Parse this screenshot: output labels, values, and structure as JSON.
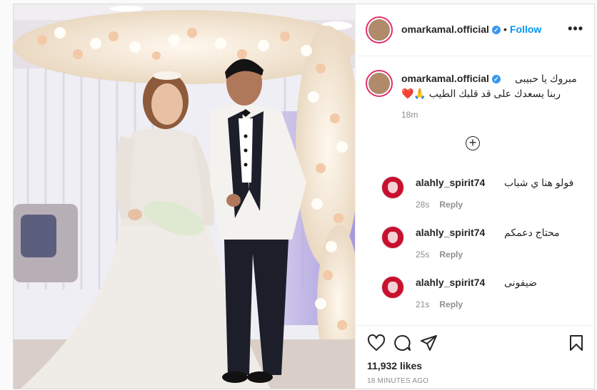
{
  "post": {
    "username": "omarkamal.official",
    "follow_label": "Follow",
    "dot": "•",
    "more": "•••",
    "verified_mark": "✓",
    "caption_line1": "مبروك يا حبيبى",
    "caption_line2": "ربنا يسعدك على قد قلبك الطيب 🙏❤️",
    "caption_time": "18m",
    "load_more": "+",
    "likes": "11,932 likes",
    "time_ago": "18 MINUTES AGO"
  },
  "comments": [
    {
      "username": "alahly_spirit74",
      "text": "فولو هنا ي شباب",
      "time": "28s",
      "reply": "Reply"
    },
    {
      "username": "alahly_spirit74",
      "text": "محتاج دعمكم",
      "time": "25s",
      "reply": "Reply"
    },
    {
      "username": "alahly_spirit74",
      "text": "ضيفونى",
      "time": "21s",
      "reply": "Reply"
    }
  ],
  "icons": {
    "like": "heart-icon",
    "comment": "comment-icon",
    "share": "paper-plane-icon",
    "save": "bookmark-icon"
  },
  "colors": {
    "follow": "#0095f6",
    "verified": "#3897f0",
    "ahly_red": "#c8102e"
  }
}
